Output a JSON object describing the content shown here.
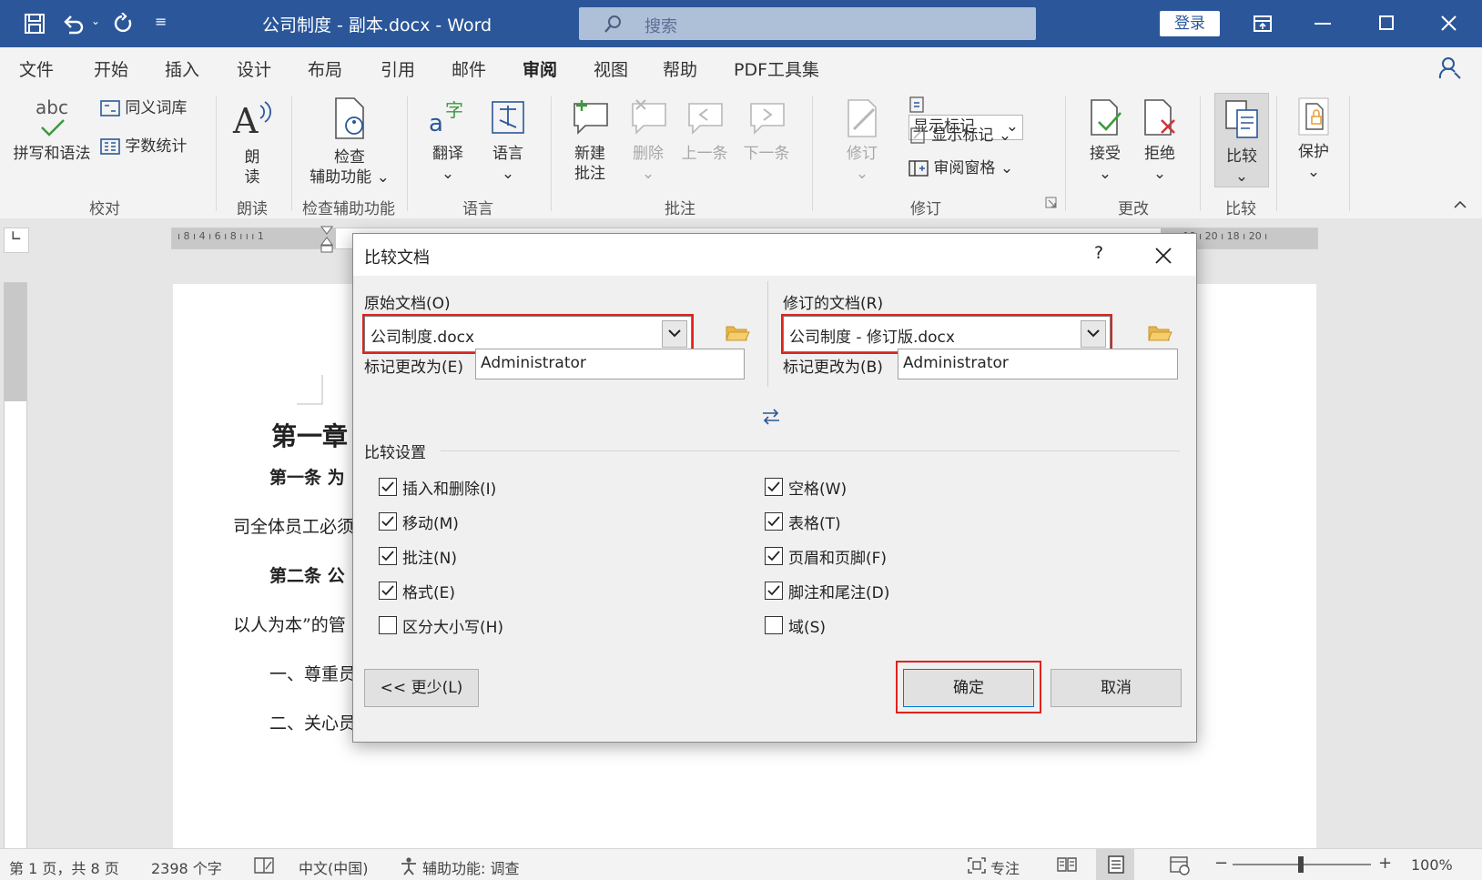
{
  "titlebar": {
    "doc_title": "公司制度 - 副本.docx  -  Word",
    "search_placeholder": "搜索",
    "login_label": "登录"
  },
  "menu": {
    "tabs": [
      "文件",
      "开始",
      "插入",
      "设计",
      "布局",
      "引用",
      "邮件",
      "审阅",
      "视图",
      "帮助",
      "PDF工具集"
    ],
    "active": "审阅"
  },
  "ribbon": {
    "spell_abc": "abc",
    "spell": "拼写和语法",
    "thesaurus": "同义词库",
    "wordcount": "字数统计",
    "read_1": "朗",
    "read_2": "读",
    "check_1": "检查",
    "check_2": "辅助功能",
    "translate": "翻译",
    "language": "语言",
    "newcomment_1": "新建",
    "newcomment_2": "批注",
    "delete": "删除",
    "prev": "上一条",
    "next": "下一条",
    "track": "修订",
    "showmarkup_select": "显示标记",
    "showmarkup": "显示标记",
    "reviewpane": "审阅窗格",
    "accept": "接受",
    "reject": "拒绝",
    "compare": "比较",
    "protect": "保护",
    "groups": {
      "proofing": "校对",
      "speech": "朗读",
      "accessibility": "检查辅助功能",
      "language": "语言",
      "comments": "批注",
      "tracking": "修订",
      "changes": "更改",
      "compare": "比较"
    }
  },
  "ruler": {
    "left_ticks": "ı 8 ı 4 ı 6 ı 8 ı ı ı 1",
    "right_ticks": "ı 18 ı 20 ı 18 ı 20 ı"
  },
  "document": {
    "heading": "第一章",
    "line1": "第一条  为",
    "line2": "司全体员工必须",
    "line3": "第二条  公",
    "line4": "以人为本”的管",
    "line5": "一、尊重员",
    "line6": "二、关心员"
  },
  "dialog": {
    "title": "比较文档",
    "help": "?",
    "original_label": "原始文档(O)",
    "original_value": "公司制度.docx",
    "revised_label": "修订的文档(R)",
    "revised_value": "公司制度 - 修订版.docx",
    "mark_left_label": "标记更改为(E)",
    "mark_left_value": "Administrator",
    "mark_right_label": "标记更改为(B)",
    "mark_right_value": "Administrator",
    "settings_label": "比较设置",
    "left_options": [
      {
        "label": "插入和删除(I)",
        "checked": true
      },
      {
        "label": "移动(M)",
        "checked": true
      },
      {
        "label": "批注(N)",
        "checked": true
      },
      {
        "label": "格式(E)",
        "checked": true
      },
      {
        "label": "区分大小写(H)",
        "checked": false
      }
    ],
    "right_options": [
      {
        "label": "空格(W)",
        "checked": true
      },
      {
        "label": "表格(T)",
        "checked": true
      },
      {
        "label": "页眉和页脚(F)",
        "checked": true
      },
      {
        "label": "脚注和尾注(D)",
        "checked": true
      },
      {
        "label": "域(S)",
        "checked": false
      }
    ],
    "less_button": "<< 更少(L)",
    "ok_button": "确定",
    "cancel_button": "取消"
  },
  "statusbar": {
    "page": "第 1 页，共 8 页",
    "words": "2398 个字",
    "lang": "中文(中国)",
    "accessibility": "辅助功能: 调查",
    "focus": "专注",
    "zoom": "100%"
  },
  "colors": {
    "title_bar": "#2b579a",
    "highlight_box": "#e0221c"
  }
}
